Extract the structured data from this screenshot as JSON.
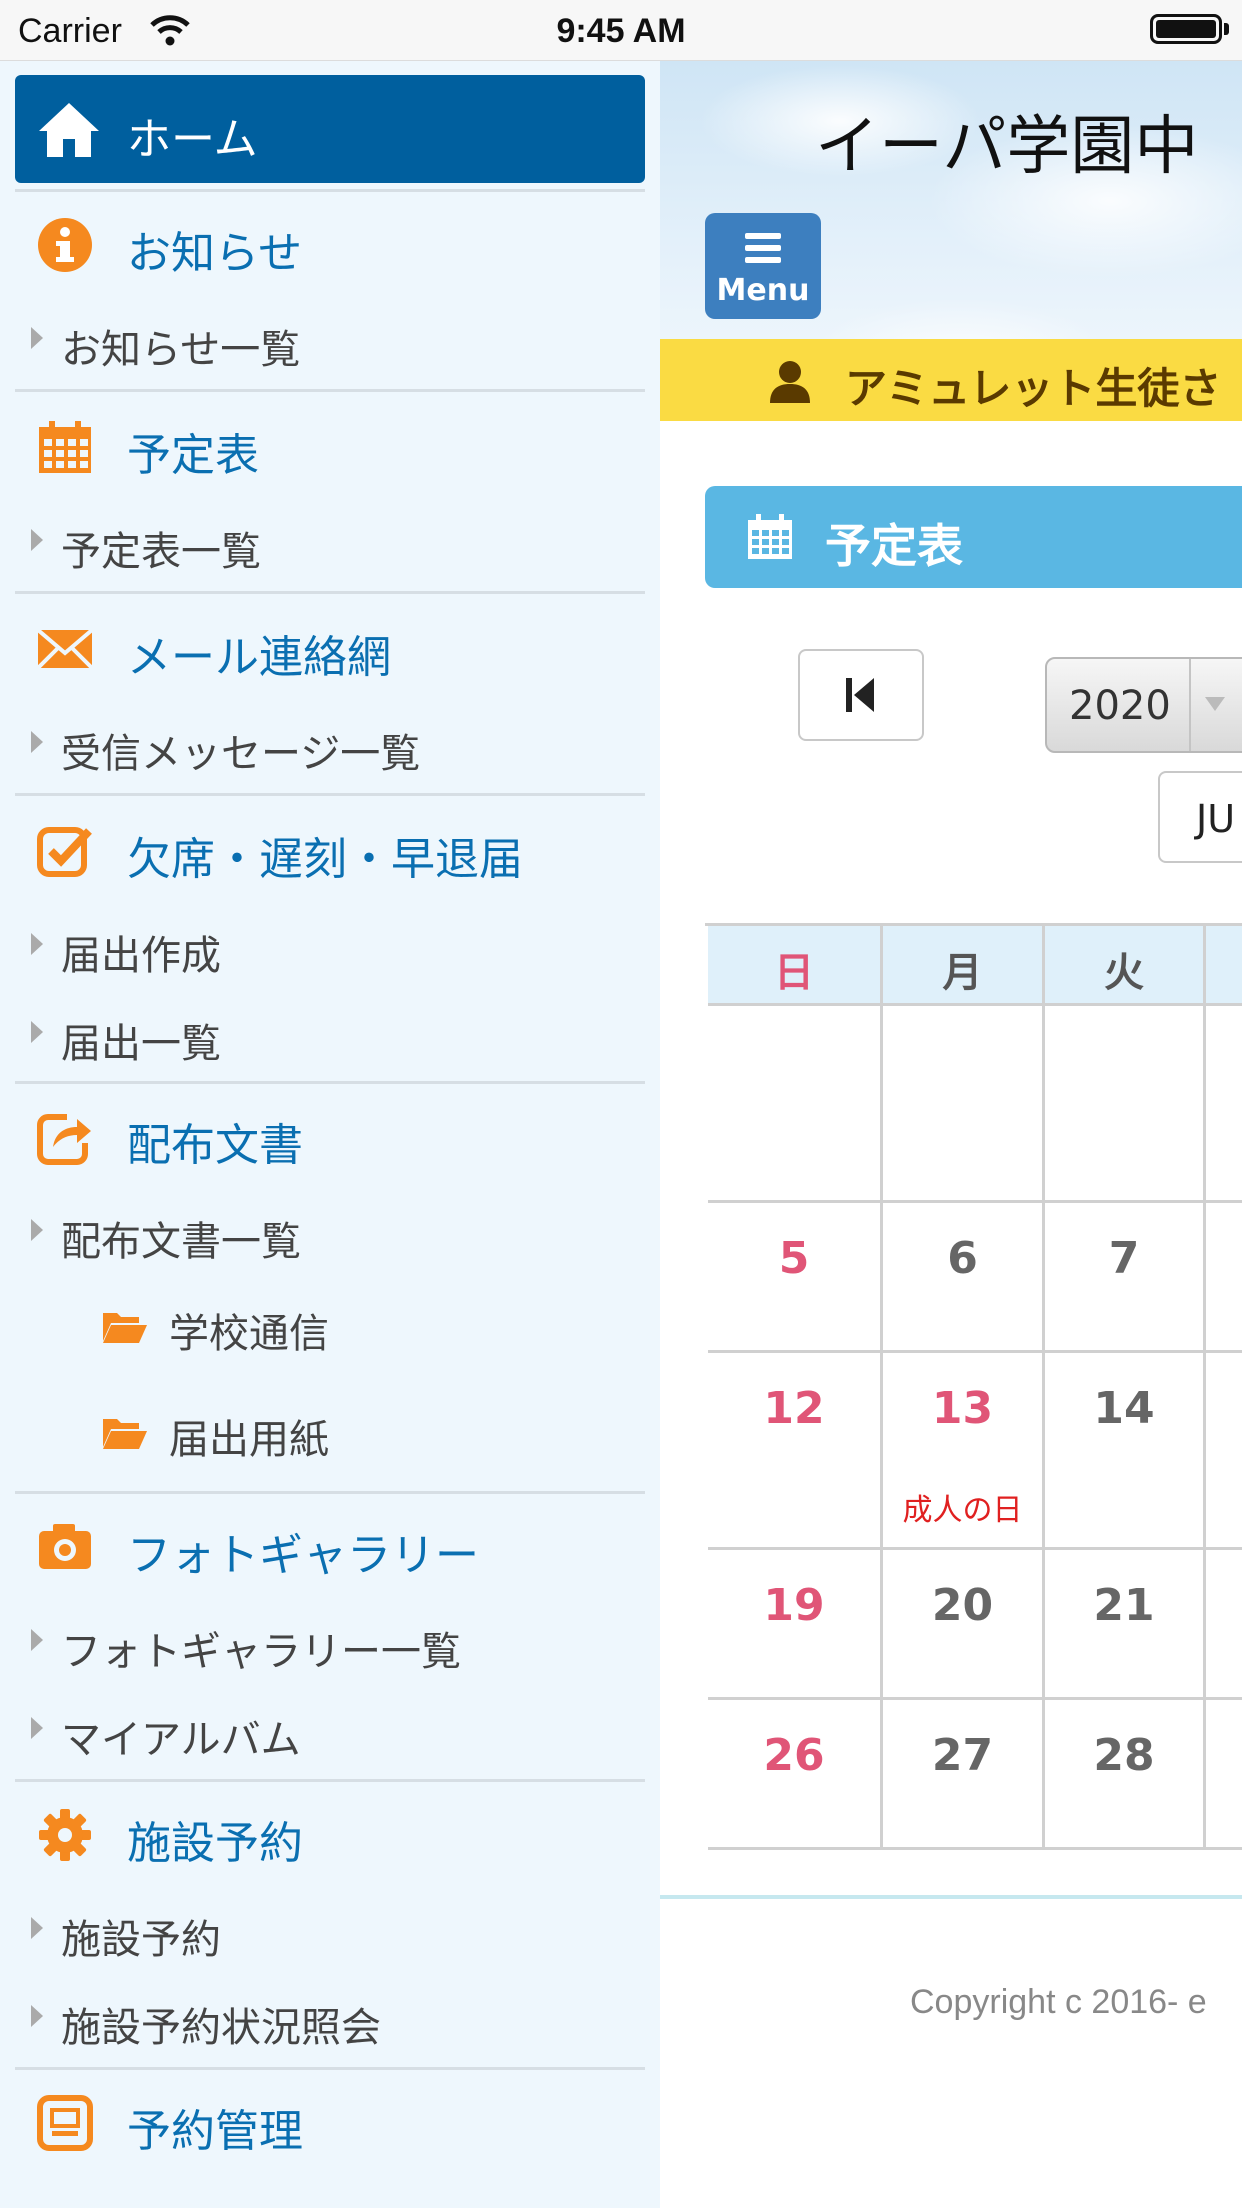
{
  "status_bar": {
    "carrier": "Carrier",
    "time": "9:45 AM"
  },
  "sidebar": {
    "home": {
      "label": "ホーム",
      "icon": "home-icon"
    },
    "sections": [
      {
        "label": "お知らせ",
        "icon": "info-icon",
        "items": [
          "お知らせ一覧"
        ]
      },
      {
        "label": "予定表",
        "icon": "calendar-icon",
        "items": [
          "予定表一覧"
        ]
      },
      {
        "label": "メール連絡網",
        "icon": "mail-icon",
        "items": [
          "受信メッセージ一覧"
        ]
      },
      {
        "label": "欠席・遅刻・早退届",
        "icon": "checkbox-icon",
        "items": [
          "届出作成",
          "届出一覧"
        ]
      },
      {
        "label": "配布文書",
        "icon": "share-icon",
        "items": [
          "配布文書一覧"
        ],
        "folders": [
          "学校通信",
          "届出用紙"
        ]
      },
      {
        "label": "フォトギャラリー",
        "icon": "camera-icon",
        "items": [
          "フォトギャラリー一覧",
          "マイアルバム"
        ]
      },
      {
        "label": "施設予約",
        "icon": "gear-icon",
        "items": [
          "施設予約",
          "施設予約状況照会"
        ]
      },
      {
        "label": "予約管理",
        "icon": "window-icon",
        "items": []
      }
    ]
  },
  "main": {
    "site_title": "イーパ学園中",
    "menu_label": "Menu",
    "notice": "アミュレット生徒さ",
    "schedule_title": "予定表",
    "year": "2020",
    "month": "JU",
    "calendar": {
      "weekdays": [
        "日",
        "月",
        "火",
        ""
      ],
      "weeks": [
        {
          "days": [
            "",
            "",
            "",
            ""
          ],
          "events": [
            "",
            "",
            "",
            ""
          ]
        },
        {
          "days": [
            "5",
            "6",
            "7",
            ""
          ],
          "events": [
            "",
            "",
            "",
            ""
          ]
        },
        {
          "days": [
            "12",
            "13",
            "14",
            ""
          ],
          "events": [
            "",
            "成人の日",
            "",
            ""
          ]
        },
        {
          "days": [
            "19",
            "20",
            "21",
            ""
          ],
          "events": [
            "",
            "",
            "",
            ""
          ]
        },
        {
          "days": [
            "26",
            "27",
            "28",
            ""
          ],
          "events": [
            "",
            "",
            "",
            ""
          ]
        }
      ]
    },
    "copyright": "Copyright c 2016- e"
  },
  "colors": {
    "primary": "#005f9e",
    "accent_orange": "#f5891f",
    "link_blue": "#0a6fb1",
    "notice_yellow": "#fadb43",
    "schedule_header": "#5ab7e3",
    "sunday_red": "#e05577",
    "holiday_event_red": "#e02020"
  }
}
